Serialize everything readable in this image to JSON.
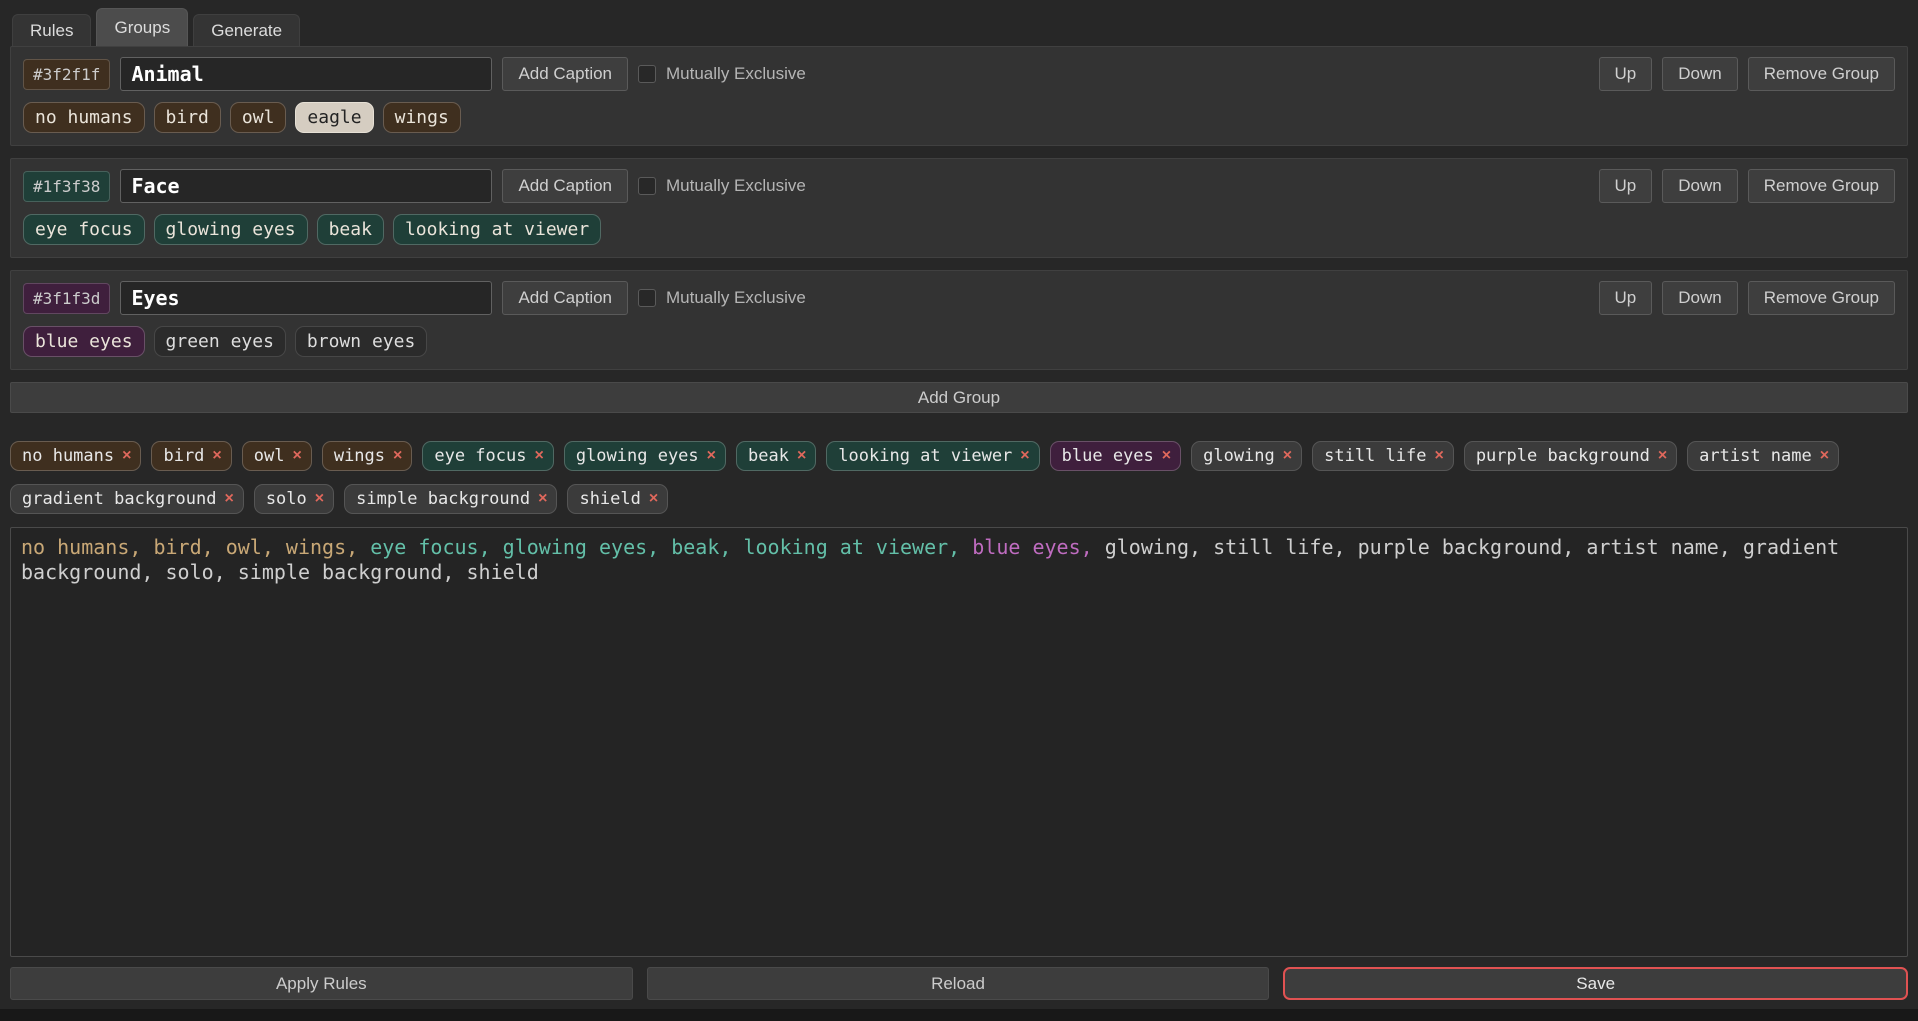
{
  "tabs": [
    {
      "id": "rules",
      "label": "Rules",
      "active": false
    },
    {
      "id": "groups",
      "label": "Groups",
      "active": true
    },
    {
      "id": "generate",
      "label": "Generate",
      "active": false
    }
  ],
  "group_controls": {
    "add_caption": "Add Caption",
    "mutually_exclusive": "Mutually Exclusive",
    "up": "Up",
    "down": "Down",
    "remove": "Remove Group",
    "add_group": "Add Group"
  },
  "groups": [
    {
      "id": "animal",
      "color": "#3f2f1f",
      "name": "Animal",
      "mutually_exclusive_checked": false,
      "tags": [
        {
          "label": "no humans",
          "state": "in-caption"
        },
        {
          "label": "bird",
          "state": "in-caption"
        },
        {
          "label": "owl",
          "state": "in-caption"
        },
        {
          "label": "eagle",
          "state": "highlighted"
        },
        {
          "label": "wings",
          "state": "in-caption"
        }
      ]
    },
    {
      "id": "face",
      "color": "#1f3f38",
      "name": "Face",
      "mutually_exclusive_checked": false,
      "tags": [
        {
          "label": "eye focus",
          "state": "in-caption"
        },
        {
          "label": "glowing eyes",
          "state": "in-caption"
        },
        {
          "label": "beak",
          "state": "in-caption"
        },
        {
          "label": "looking at viewer",
          "state": "in-caption"
        }
      ]
    },
    {
      "id": "eyes",
      "color": "#3f1f3d",
      "name": "Eyes",
      "mutually_exclusive_checked": false,
      "tags": [
        {
          "label": "blue eyes",
          "state": "in-caption"
        },
        {
          "label": "green eyes",
          "state": "not-in-caption"
        },
        {
          "label": "brown eyes",
          "state": "not-in-caption"
        }
      ]
    }
  ],
  "caption_chips": [
    {
      "label": "no humans",
      "group": "animal"
    },
    {
      "label": "bird",
      "group": "animal"
    },
    {
      "label": "owl",
      "group": "animal"
    },
    {
      "label": "wings",
      "group": "animal"
    },
    {
      "label": "eye focus",
      "group": "face"
    },
    {
      "label": "glowing eyes",
      "group": "face"
    },
    {
      "label": "beak",
      "group": "face"
    },
    {
      "label": "looking at viewer",
      "group": "face"
    },
    {
      "label": "blue eyes",
      "group": "eyes"
    },
    {
      "label": "glowing",
      "group": null
    },
    {
      "label": "still life",
      "group": null
    },
    {
      "label": "purple background",
      "group": null
    },
    {
      "label": "artist name",
      "group": null
    },
    {
      "label": "gradient background",
      "group": null
    },
    {
      "label": "solo",
      "group": null
    },
    {
      "label": "simple background",
      "group": null
    },
    {
      "label": "shield",
      "group": null
    }
  ],
  "chip_remove_glyph": "×",
  "caption_segments": [
    {
      "text": "no humans, bird, owl, wings, ",
      "color": "#c9a876"
    },
    {
      "text": "eye focus, glowing eyes, beak, looking at viewer, ",
      "color": "#63bfa8"
    },
    {
      "text": "blue eyes, ",
      "color": "#bf6cc0"
    },
    {
      "text": "glowing, still life, purple background, artist name, gradient background, solo, simple background, shield",
      "color": "#cfcfcf"
    }
  ],
  "colors": {
    "remove_x": "#e0685c",
    "save_border": "#e05252",
    "group_animal": "#3f2f1f",
    "group_face": "#1f3f38",
    "group_eyes": "#3f1f3d"
  },
  "footer": [
    {
      "id": "apply-rules",
      "label": "Apply Rules",
      "accent": false
    },
    {
      "id": "reload",
      "label": "Reload",
      "accent": false
    },
    {
      "id": "save",
      "label": "Save",
      "accent": true
    }
  ]
}
